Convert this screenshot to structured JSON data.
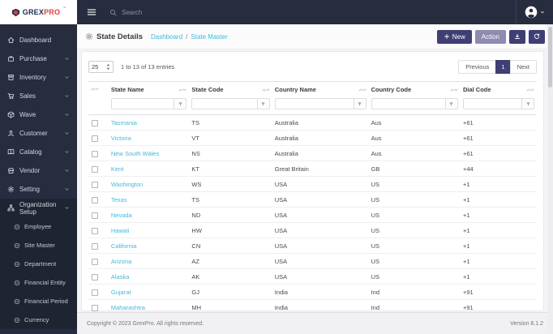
{
  "brand": {
    "primary": "GREX",
    "secondary": "PRO",
    "trademark": "™"
  },
  "navbar": {
    "search_placeholder": "Search"
  },
  "sidebar": {
    "items": [
      {
        "label": "Dashboard",
        "icon": "home-icon",
        "expandable": false
      },
      {
        "label": "Purchase",
        "icon": "briefcase-icon",
        "expandable": true
      },
      {
        "label": "Inventory",
        "icon": "archive-icon",
        "expandable": true
      },
      {
        "label": "Sales",
        "icon": "cart-icon",
        "expandable": true
      },
      {
        "label": "Wave",
        "icon": "box-icon",
        "expandable": true
      },
      {
        "label": "Customer",
        "icon": "person-icon",
        "expandable": true
      },
      {
        "label": "Catalog",
        "icon": "book-icon",
        "expandable": true
      },
      {
        "label": "Vendor",
        "icon": "store-icon",
        "expandable": true
      },
      {
        "label": "Setting",
        "icon": "gear-icon",
        "expandable": true
      }
    ],
    "submenu": {
      "label": "Organization Setup",
      "icon": "sitemap-icon",
      "items": [
        "Employee",
        "Site Master",
        "Department",
        "Financial Entity",
        "Financial Period",
        "Currency"
      ]
    }
  },
  "header": {
    "page_title": "State Details",
    "breadcrumb": {
      "items": [
        "Dashboard",
        "State Master"
      ],
      "separator": "/"
    },
    "actions": {
      "new_label": "New",
      "action_label": "Action"
    }
  },
  "controls": {
    "page_size": "25",
    "entries_info": "1 to 13 of 13 entries"
  },
  "pagination": {
    "previous_label": "Previous",
    "current_page": "1",
    "next_label": "Next"
  },
  "table": {
    "columns": [
      "State Name",
      "State Code",
      "Country Name",
      "Country Code",
      "Dial Code"
    ],
    "rows": [
      [
        "Tasmania",
        "TS",
        "Australia",
        "Aus",
        "+61"
      ],
      [
        "Victoria",
        "VT",
        "Australia",
        "Aus",
        "+61"
      ],
      [
        "New South Wales",
        "NS",
        "Australia",
        "Aus",
        "+61"
      ],
      [
        "Kent",
        "KT",
        "Great Britain",
        "GB",
        "+44"
      ],
      [
        "Washington",
        "WS",
        "USA",
        "US",
        "+1"
      ],
      [
        "Texas",
        "TS",
        "USA",
        "US",
        "+1"
      ],
      [
        "Nevada",
        "ND",
        "USA",
        "US",
        "+1"
      ],
      [
        "Hawaii",
        "HW",
        "USA",
        "US",
        "+1"
      ],
      [
        "California",
        "CN",
        "USA",
        "US",
        "+1"
      ],
      [
        "Arizona",
        "AZ",
        "USA",
        "US",
        "+1"
      ],
      [
        "Alaska",
        "AK",
        "USA",
        "US",
        "+1"
      ],
      [
        "Gujarat",
        "GJ",
        "India",
        "Ind",
        "+91"
      ],
      [
        "Maharashtra",
        "MH",
        "India",
        "Ind",
        "+91"
      ]
    ]
  },
  "footer": {
    "copyright": "Copyright © 2023 GrexPro. All rights reserved.",
    "version": "Version 8.1.2"
  },
  "colors": {
    "accent": "#45b8d8",
    "primary_button": "#3f3e75",
    "secondary_button": "#8d8bb0",
    "sidebar_bg": "#272c3f",
    "brand_red": "#e23b3b"
  }
}
